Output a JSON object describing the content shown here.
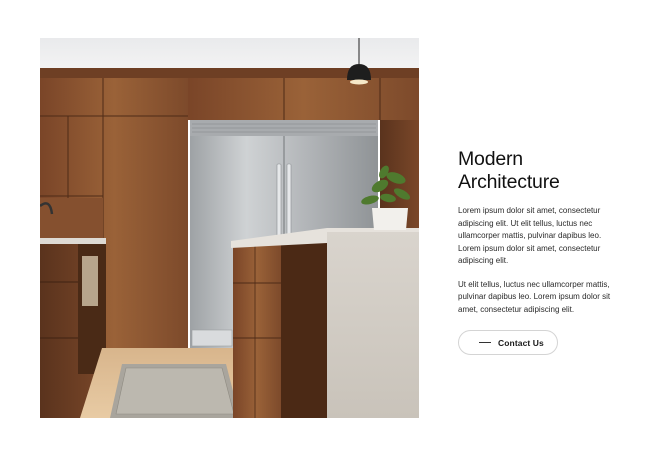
{
  "hero": {
    "image_description_icon": "kitchen-photo"
  },
  "content": {
    "title_line1": "Modern",
    "title_line2": "Architecture",
    "paragraph1": "Lorem ipsum dolor sit amet, consectetur adipiscing elit. Ut elit tellus, luctus nec ullamcorper mattis, pulvinar dapibus leo. Lorem ipsum dolor sit amet, consectetur adipiscing elit.",
    "paragraph2": "Ut elit tellus, luctus nec ullamcorper mattis, pulvinar dapibus leo. Lorem ipsum dolor sit amet, consectetur adipiscing elit.",
    "cta_label": "Contact Us"
  },
  "colors": {
    "wood": "#8a5432",
    "steel": "#b9bcbe",
    "counter": "#d8d3cc",
    "text": "#1a1a1a"
  }
}
